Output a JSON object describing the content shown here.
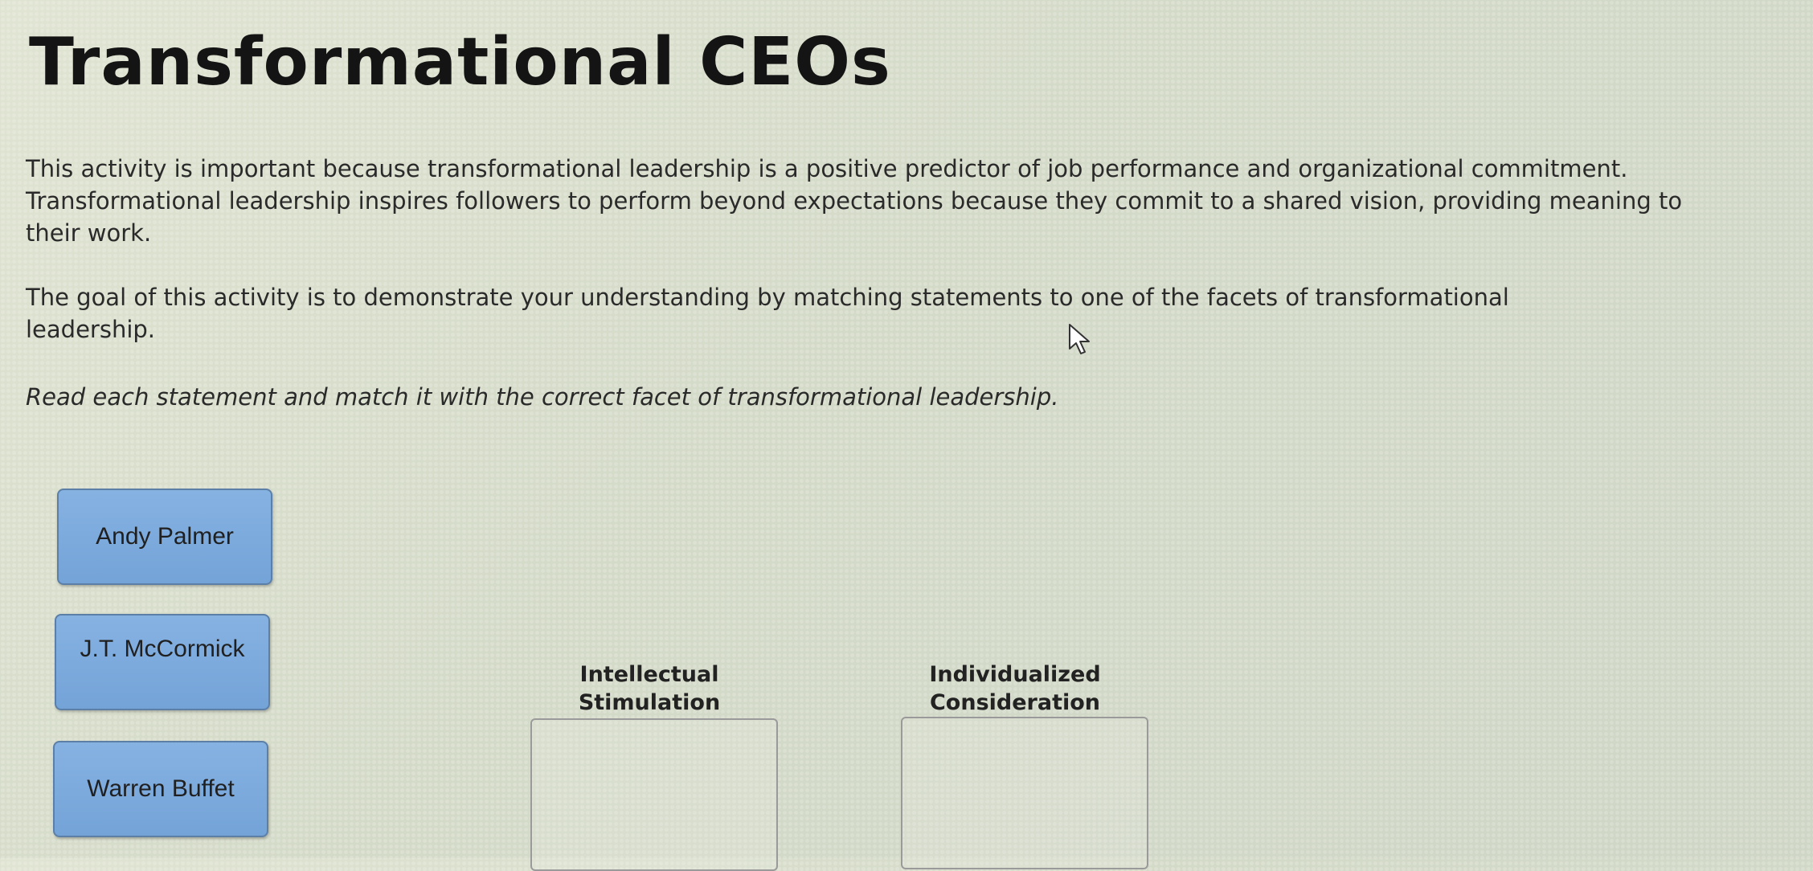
{
  "title": "Transformational CEOs",
  "paragraphs": {
    "intro": "This activity is important because transformational leadership is a positive predictor of job performance and organizational commitment. Transformational leadership inspires followers to perform beyond expectations because they commit to a shared vision, providing meaning to their work.",
    "goal": "The goal of this activity is to demonstrate your understanding by matching statements to one of the facets of transformational leadership.",
    "instruction": "Read each statement and match it with the correct facet of transformational leadership."
  },
  "choices": [
    {
      "label": "Andy Palmer"
    },
    {
      "label": "J.T. McCormick"
    },
    {
      "label": "Warren Buffet"
    }
  ],
  "targets": [
    {
      "label": "Intellectual Stimulation"
    },
    {
      "label": "Individualized Consideration"
    }
  ],
  "colors": {
    "choice_fill": "#7ca9dc",
    "choice_border": "#5b7fa7",
    "dropzone_border": "#9a9a9a"
  },
  "icons": {
    "cursor": "mouse-pointer-icon"
  }
}
